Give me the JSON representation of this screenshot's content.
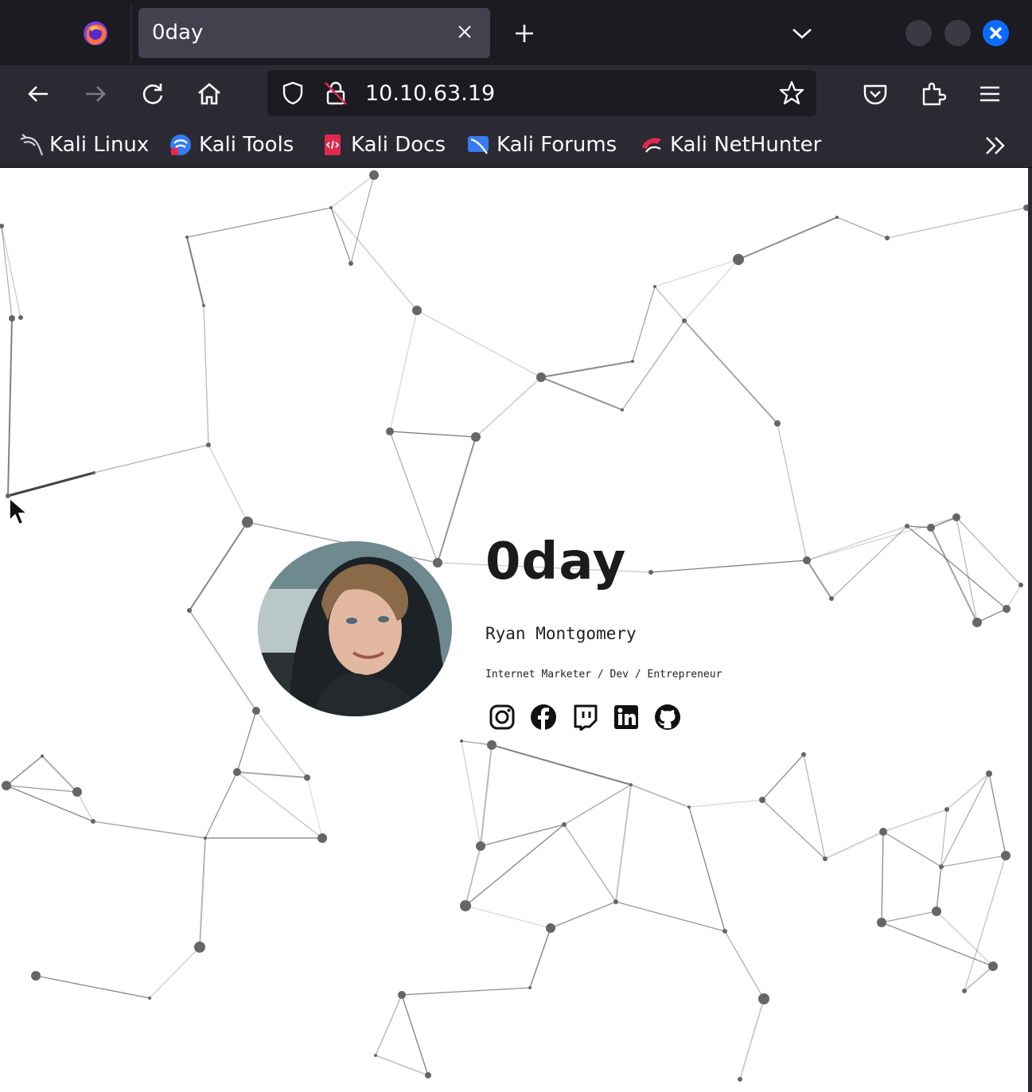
{
  "browser": {
    "tab": {
      "title": "0day"
    },
    "url": "10.10.63.19",
    "bookmarks": [
      {
        "label": "Kali Linux",
        "icon": "kali-dragon-icon"
      },
      {
        "label": "Kali Tools",
        "icon": "kali-tools-icon"
      },
      {
        "label": "Kali Docs",
        "icon": "kali-docs-icon"
      },
      {
        "label": "Kali Forums",
        "icon": "kali-forums-icon"
      },
      {
        "label": "Kali NetHunter",
        "icon": "kali-nethunter-icon"
      }
    ],
    "colors": {
      "frame": "#1c1b22",
      "toolbar": "#2b2a33",
      "tab_active": "#42414d",
      "close_button": "#0a6cff"
    }
  },
  "page": {
    "title": "0day",
    "name": "Ryan Montgomery",
    "tagline": "Internet Marketer / Dev / Entrepreneur",
    "socials": [
      {
        "name": "instagram-icon"
      },
      {
        "name": "facebook-icon"
      },
      {
        "name": "twitch-icon"
      },
      {
        "name": "linkedin-icon"
      },
      {
        "name": "github-icon"
      }
    ],
    "background": "particle-network"
  }
}
